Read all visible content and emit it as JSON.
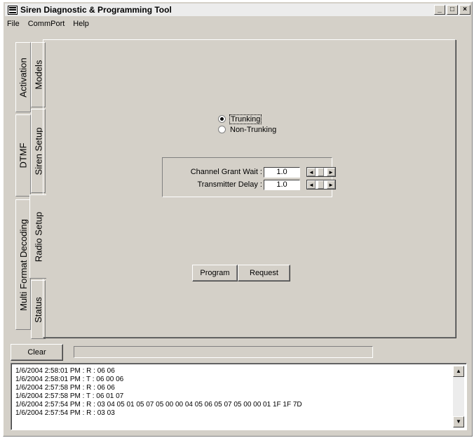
{
  "window": {
    "title": "Siren Diagnostic & Programming Tool",
    "minimize": "_",
    "maximize": "□",
    "close": "×"
  },
  "menu": [
    "File",
    "CommPort",
    "Help"
  ],
  "tabs": {
    "outer": [
      "Activation",
      "DTMF",
      "Multi Format Decoding"
    ],
    "inner": [
      "Models",
      "Siren Setup",
      "Radio Setup",
      "Status"
    ],
    "active": "Radio Setup"
  },
  "radio_setup": {
    "mode_options": [
      {
        "label": "Trunking",
        "selected": true
      },
      {
        "label": "Non-Trunking",
        "selected": false
      }
    ],
    "channel_grant_wait_label": "Channel Grant Wait :",
    "channel_grant_wait_value": "1.0",
    "transmitter_delay_label": "Transmitter Delay :",
    "transmitter_delay_value": "1.0",
    "program_label": "Program",
    "request_label": "Request"
  },
  "bottom": {
    "clear_label": "Clear",
    "progress_fraction": 0
  },
  "log": [
    "1/6/2004 2:58:01 PM : R : 06 06",
    "1/6/2004 2:58:01 PM : T : 06 00 06",
    "1/6/2004 2:57:58 PM : R : 06 06",
    "1/6/2004 2:57:58 PM : T : 06 01 07",
    "1/6/2004 2:57:54 PM : R : 03 04 05 01 05 07 05 00 00 04 05 06 05 07 05 00 00 01 1F 1F 7D",
    "1/6/2004 2:57:54 PM : R : 03 03"
  ],
  "icons": {
    "app": "app-icon",
    "left_arrow": "◄",
    "right_arrow": "►",
    "up_arrow": "▲",
    "down_arrow": "▼"
  }
}
